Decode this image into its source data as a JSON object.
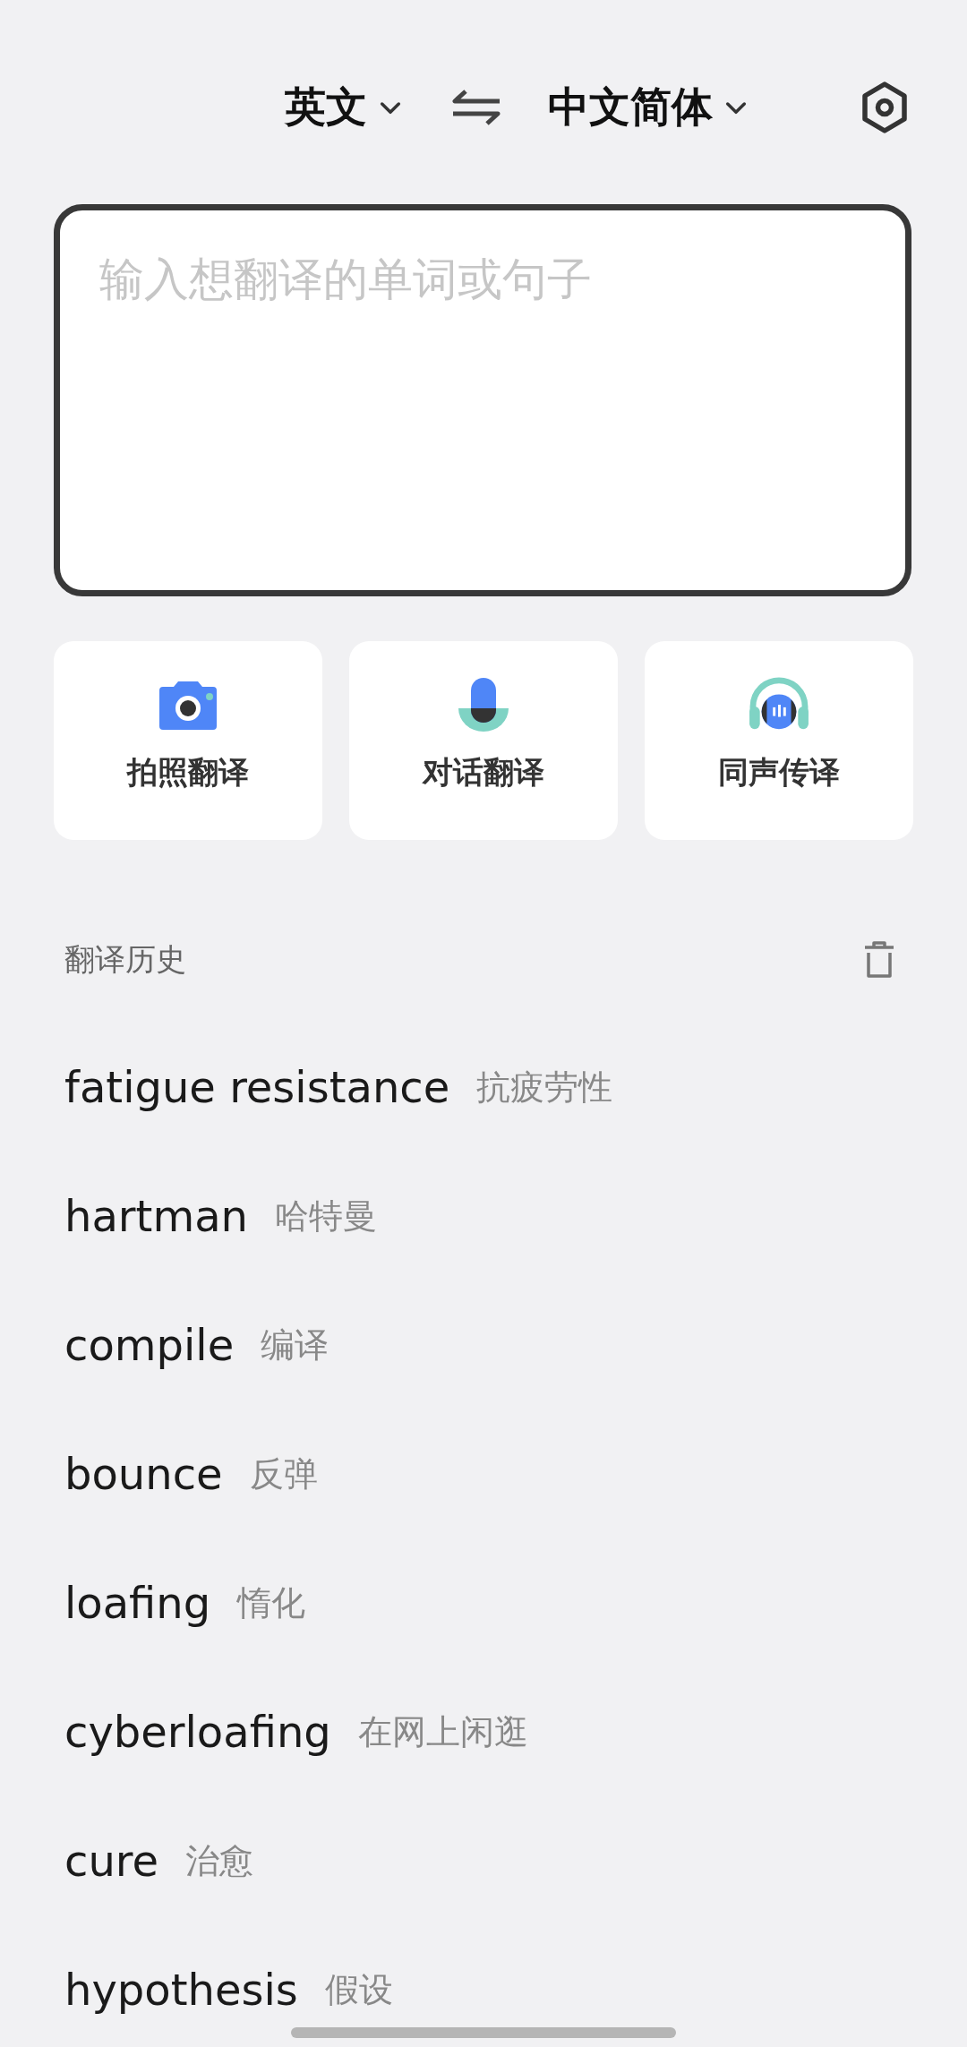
{
  "top_bar": {
    "source_language": "英文",
    "target_language": "中文简体"
  },
  "input": {
    "placeholder": "输入想翻译的单词或句子"
  },
  "features": [
    {
      "kind": "camera",
      "label": "拍照翻译"
    },
    {
      "kind": "microphone",
      "label": "对话翻译"
    },
    {
      "kind": "headphones",
      "label": "同声传译"
    }
  ],
  "history": {
    "title": "翻译历史",
    "items": [
      {
        "source": "fatigue resistance",
        "translation": "抗疲劳性"
      },
      {
        "source": "hartman",
        "translation": "哈特曼"
      },
      {
        "source": "compile",
        "translation": "编译"
      },
      {
        "source": "bounce",
        "translation": "反弹"
      },
      {
        "source": "loafing",
        "translation": "惰化"
      },
      {
        "source": "cyberloafing",
        "translation": "在网上闲逛"
      },
      {
        "source": "cure",
        "translation": "治愈"
      },
      {
        "source": "hypothesis",
        "translation": "假设"
      }
    ]
  }
}
